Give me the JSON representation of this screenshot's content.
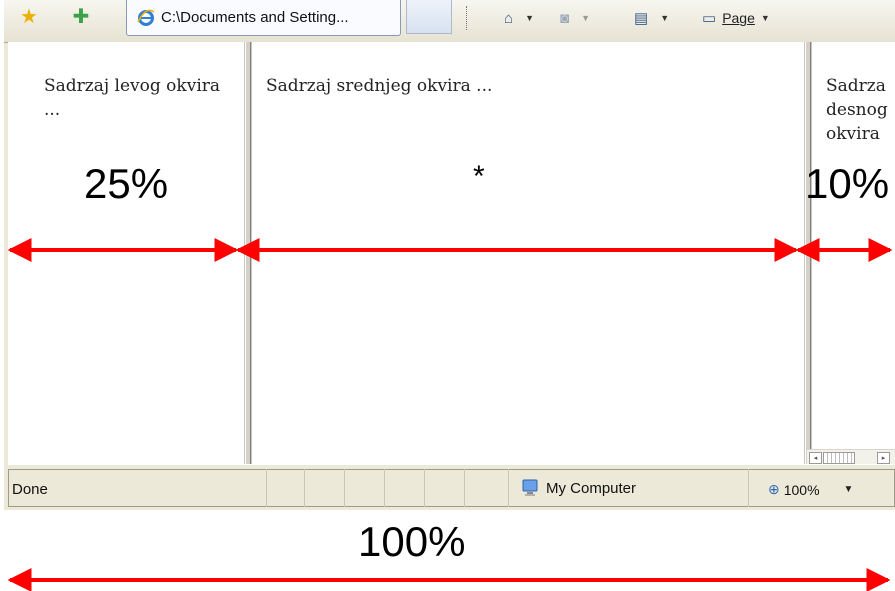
{
  "toolbar": {
    "favorites_icon": "star-icon",
    "add_favorites_icon": "add-star-icon",
    "tab_title": "C:\\Documents and Setting...",
    "tab_icon": "internet-explorer-icon",
    "home_icon": "home-icon",
    "feeds_icon": "rss-feed-icon",
    "print_icon": "printer-icon",
    "page_label": "Page"
  },
  "frames": {
    "left_text": "Sadrzaj levog okvira ...",
    "middle_text": "Sadrzaj srednjeg okvira ...",
    "right_text": "Sadrza\ndesnog\nokvira"
  },
  "statusbar": {
    "status_text": "Done",
    "zone_text": "My Computer",
    "zoom_text": "100%"
  },
  "annotations": {
    "left_width": "25%",
    "middle_width": "*",
    "right_width": "10%",
    "total_width": "100%"
  },
  "colors": {
    "arrow": "#ff0000",
    "chrome": "#ece9d8"
  }
}
